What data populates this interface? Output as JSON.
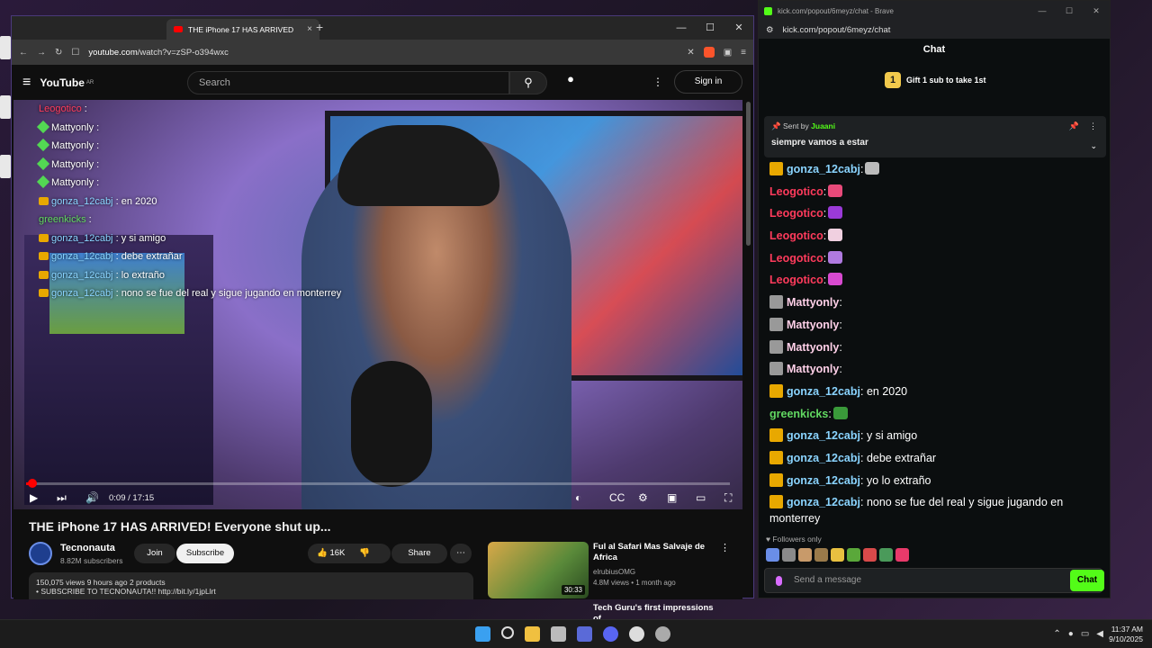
{
  "desktop": {
    "topleft_overlay": [
      "Leogotico :",
      "Leogotico :"
    ]
  },
  "browser": {
    "tab_title": "THE iPhone 17 HAS ARRIVED",
    "url_host": "youtube.com",
    "url_path": "/watch?v=zSP-o394wxc",
    "win_controls": [
      "—",
      "☐",
      "✕"
    ]
  },
  "youtube": {
    "logo": "YouTube",
    "region": "AR",
    "search_placeholder": "Search",
    "sign_in": "Sign in",
    "player": {
      "time": "0:09 / 17:15",
      "progress_fraction": 0.009
    },
    "video": {
      "title": "THE iPhone 17 HAS ARRIVED! Everyone shut up...",
      "channel": "Tecnonauta",
      "subscribers": "8.82M subscribers",
      "join": "Join",
      "subscribe": "Subscribe",
      "likes": "16K",
      "share": "Share",
      "views_line": "150,075 views  9 hours ago  2 products",
      "desc_line": "• SUBSCRIBE TO TECNONAUTA!!   http://bit.ly/1jpLlrt"
    },
    "recommended": [
      {
        "title": "Ful al Safari Mas Salvaje de Africa",
        "channel": "elrubiusOMG",
        "meta": "4.8M views • 1 month ago",
        "duration": "30:33"
      },
      {
        "title": "Tech Guru's first impressions of"
      }
    ]
  },
  "overlay_chat": [
    {
      "name": "Leogotico",
      "sep": " :",
      "text": "",
      "color": "n-p",
      "badge": "none"
    },
    {
      "name": "Mattyonly",
      "sep": " :",
      "text": "",
      "color": "n-w",
      "badge": "leaf"
    },
    {
      "name": "Mattyonly",
      "sep": " :",
      "text": "",
      "color": "n-w",
      "badge": "leaf"
    },
    {
      "name": "Mattyonly",
      "sep": " :",
      "text": "",
      "color": "n-w",
      "badge": "leaf"
    },
    {
      "name": "Mattyonly",
      "sep": " :",
      "text": "",
      "color": "n-w",
      "badge": "leaf"
    },
    {
      "name": "gonza_12cabj",
      "sep": " :",
      "text": " en 2020",
      "color": "n-g",
      "badge": "crown"
    },
    {
      "name": "greenkicks",
      "sep": " :",
      "text": "",
      "color": "n-gr",
      "badge": "none"
    },
    {
      "name": "gonza_12cabj",
      "sep": " :",
      "text": " y si amigo",
      "color": "n-g",
      "badge": "crown"
    },
    {
      "name": "gonza_12cabj",
      "sep": " :",
      "text": " debe extrañar",
      "color": "n-g",
      "badge": "crown"
    },
    {
      "name": "gonza_12cabj",
      "sep": " :",
      "text": " lo extraño",
      "color": "n-g",
      "badge": "crown"
    },
    {
      "name": "gonza_12cabj",
      "sep": " :",
      "text": " nono se fue del real y sigue jugando en monterrey",
      "color": "n-g",
      "badge": "crown"
    }
  ],
  "kick": {
    "window_title": "kick.com/popout/6meyz/chat - Brave",
    "url": "kick.com/popout/6meyz/chat",
    "chat_header": "Chat",
    "gift_text": "Gift 1 sub to take 1st",
    "gift_rank": "1",
    "pinned_sent_by": "Sent by",
    "pinned_user": "Juaani",
    "pinned_message": "siempre vamos a estar",
    "messages": [
      {
        "name": "gonza_12cabj",
        "color": "#8ad4ff",
        "badge": "#e8a800",
        "text": "",
        "emote": "#bbbbbb"
      },
      {
        "name": "Leogotico",
        "color": "#ff3b5c",
        "badge": "",
        "text": "",
        "emote": "#e84a7a"
      },
      {
        "name": "Leogotico",
        "color": "#ff3b5c",
        "badge": "",
        "text": "",
        "emote": "#9a3ad8"
      },
      {
        "name": "Leogotico",
        "color": "#ff3b5c",
        "badge": "",
        "text": "",
        "emote": "#f0d0e0"
      },
      {
        "name": "Leogotico",
        "color": "#ff3b5c",
        "badge": "",
        "text": "",
        "emote": "#b07ae0"
      },
      {
        "name": "Leogotico",
        "color": "#ff3b5c",
        "badge": "",
        "text": "",
        "emote": "#d84ad0"
      },
      {
        "name": "Mattyonly",
        "color": "#ffd0e8",
        "badge": "#999999",
        "text": "",
        "emote": ""
      },
      {
        "name": "Mattyonly",
        "color": "#ffd0e8",
        "badge": "#999999",
        "text": "",
        "emote": ""
      },
      {
        "name": "Mattyonly",
        "color": "#ffd0e8",
        "badge": "#999999",
        "text": "",
        "emote": ""
      },
      {
        "name": "Mattyonly",
        "color": "#ffd0e8",
        "badge": "#999999",
        "text": "",
        "emote": ""
      },
      {
        "name": "gonza_12cabj",
        "color": "#8ad4ff",
        "badge": "#e8a800",
        "text": " en 2020",
        "emote": ""
      },
      {
        "name": "greenkicks",
        "color": "#62d962",
        "badge": "",
        "text": "",
        "emote": "#3a9a3a"
      },
      {
        "name": "gonza_12cabj",
        "color": "#8ad4ff",
        "badge": "#e8a800",
        "text": " y si amigo",
        "emote": ""
      },
      {
        "name": "gonza_12cabj",
        "color": "#8ad4ff",
        "badge": "#e8a800",
        "text": " debe extrañar",
        "emote": ""
      },
      {
        "name": "gonza_12cabj",
        "color": "#8ad4ff",
        "badge": "#e8a800",
        "text": " yo lo extraño",
        "emote": ""
      },
      {
        "name": "gonza_12cabj",
        "color": "#8ad4ff",
        "badge": "#e8a800",
        "text": " nono se fue del real y sigue jugando en monterrey",
        "emote": ""
      }
    ],
    "followers_only": "Followers only",
    "input_placeholder": "Send a message",
    "chat_button": "Chat",
    "accent": "#53fc18"
  },
  "taskbar": {
    "time": "11:37 AM",
    "date": "9/10/2025"
  }
}
